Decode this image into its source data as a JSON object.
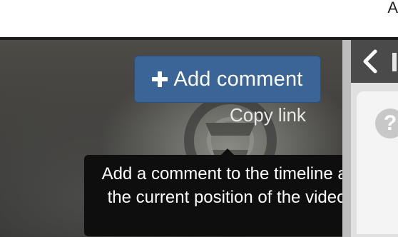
{
  "top_bar": {
    "corner_text": "A"
  },
  "video": {
    "add_comment_label": "Add comment",
    "copy_link_label": "Copy link",
    "tooltip_text": "Add a comment to the timeline at the current position of the video"
  },
  "side_panel": {
    "help_symbol": "?"
  },
  "icons": {
    "plus": "plus-icon",
    "back": "chevron-left-icon",
    "help": "question-circle-icon",
    "watermark": "logo-watermark-icon"
  },
  "colors": {
    "button_bg": "#3b6596",
    "tooltip_bg": "#0e0e0e",
    "panel_header": "#4a4a4a"
  }
}
